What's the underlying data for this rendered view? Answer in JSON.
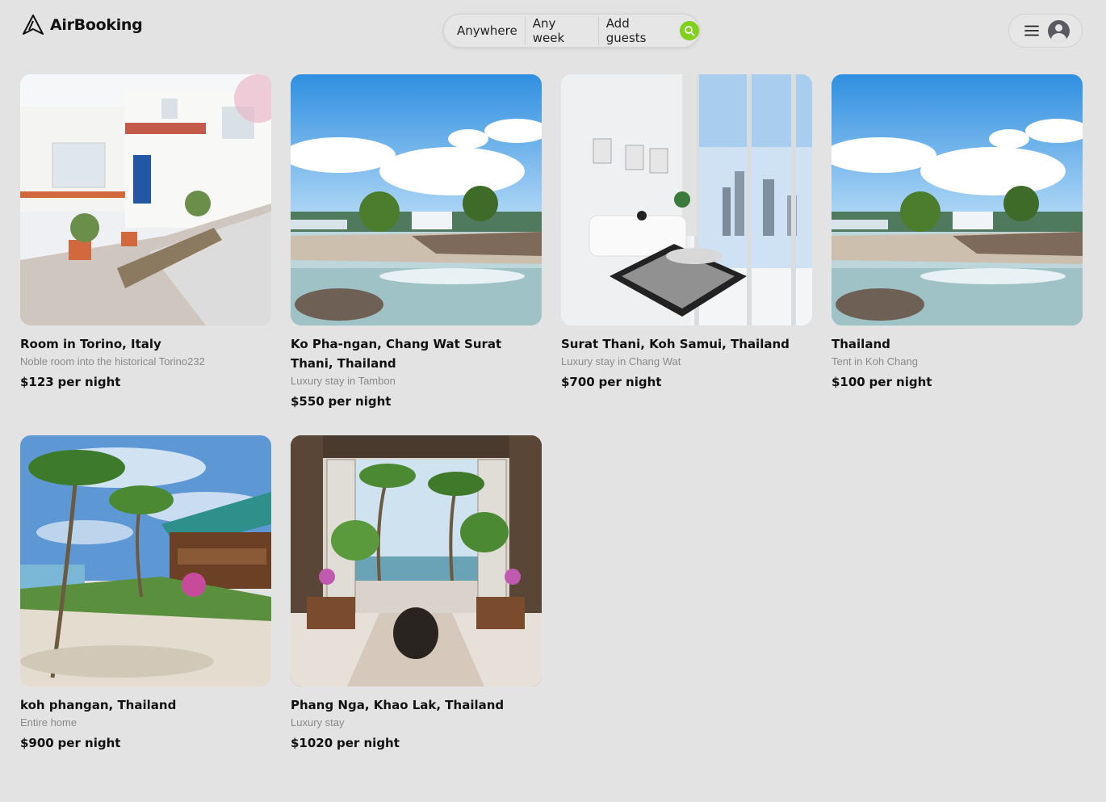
{
  "header": {
    "brand": "AirBooking",
    "logo_icon": "airbnb-logo-icon",
    "search": {
      "where": "Anywhere",
      "when": "Any week",
      "who": "Add guests",
      "button_icon": "search-icon",
      "button_color": "#7fd11c"
    },
    "user_menu": {
      "menu_icon": "hamburger-menu-icon",
      "avatar_icon": "user-avatar-icon"
    }
  },
  "listings": [
    {
      "title": "Room in Torino, Italy",
      "subtitle": "Noble room into the historical Torino232",
      "price": "$123",
      "price_suffix": "per night",
      "image": "white terraced house with flower pots"
    },
    {
      "title": "Ko Pha-ngan, Chang Wat Surat Thani, Thailand",
      "subtitle": "Luxury stay in Tambon",
      "price": "$550",
      "price_suffix": "per night",
      "image": "rocky beach with sea and blue sky"
    },
    {
      "title": "Surat Thani, Koh Samui, Thailand",
      "subtitle": "Luxury stay in Chang Wat",
      "price": "$700",
      "price_suffix": "per night",
      "image": "white living room with checkered rug and city view"
    },
    {
      "title": "Thailand",
      "subtitle": "Tent in Koh Chang",
      "price": "$100",
      "price_suffix": "per night",
      "image": "rocky beach with sea and blue sky"
    },
    {
      "title": "koh phangan, Thailand",
      "subtitle": "Entire home",
      "price": "$900",
      "price_suffix": "per night",
      "image": "beach house with palm trees and sand"
    },
    {
      "title": "Phang Nga, Khao Lak, Thailand",
      "subtitle": "Luxury stay",
      "price": "$1020",
      "price_suffix": "per night",
      "image": "open pavilion lounge with palm garden view"
    }
  ]
}
